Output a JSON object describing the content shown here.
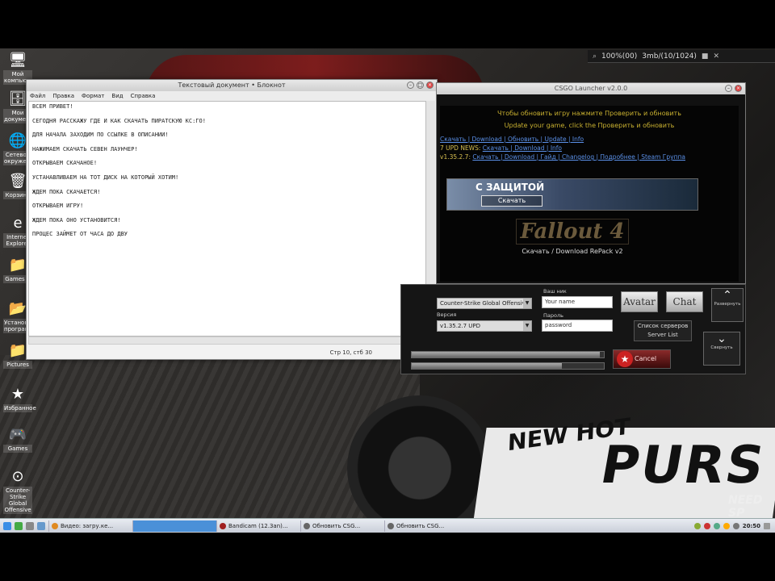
{
  "top_panel": {
    "items": [
      "100%(00)",
      "3mb/(10/1024)"
    ]
  },
  "desktop_icons": [
    {
      "label": "Мой компьютер",
      "glyph": "🖥"
    },
    {
      "label": "Мои документы",
      "glyph": "🗄"
    },
    {
      "label": "Сетевое окружение",
      "glyph": "🌐"
    },
    {
      "label": "Корзина",
      "glyph": "🗑"
    },
    {
      "label": "Internet Explorer",
      "glyph": "e"
    },
    {
      "label": "Games R",
      "glyph": "📁"
    },
    {
      "label": "Установка программ",
      "glyph": "📂"
    },
    {
      "label": "Pictures",
      "glyph": "📁"
    },
    {
      "label": "Избранное",
      "glyph": "★"
    },
    {
      "label": "Games",
      "glyph": "🎮"
    },
    {
      "label": "Counter-Strike Global Offensive",
      "glyph": "⊙"
    }
  ],
  "editor": {
    "title": "Текстовый документ • Блокнот",
    "menu": [
      "Файл",
      "Правка",
      "Формат",
      "Вид",
      "Справка"
    ],
    "lines": [
      "ВСЕМ ПРИВЕТ!",
      "СЕГОДНЯ РАССКАЖУ ГДЕ И КАК СКАЧАТЬ ПИРАТСКУЮ КС:ГО!",
      "ДЛЯ НАЧАЛА ЗАХОДИМ ПО ССЫЛКЕ В ОПИСАНИИ!",
      "НАЖИМАЕМ СКАЧАТЬ СЕВЕН ЛАУНЧЕР!",
      "ОТКРЫВАЕМ СКАЧАНОЕ!",
      "УСТАНАВЛИВАЕМ НА ТОТ ДИСК НА КОТОРЫЙ ХОТИМ!",
      "ЖДЕМ ПОКА СКАЧАЕТСЯ!",
      "ОТКРЫВАЕМ ИГРУ!",
      "ЖДЕМ ПОКА ОНО УСТАНОВИТСЯ!",
      "ПРОЦЕС ЗАЙМЕТ ОТ ЧАСА ДО ДВУ"
    ],
    "status": "Стр 10, стб 30"
  },
  "launcher": {
    "title": "CSGO Launcher v2.0.0",
    "header_line1": "Чтобы обновить игру нажмите Проверить и обновить",
    "header_line2": "Update your game, click the Проверить и обновить",
    "links": [
      {
        "prefix": "",
        "text": "Скачать | Download | Обновить | Update | Info"
      },
      {
        "prefix": "7 UPD NEWS: ",
        "text": "Скачать | Download | Info"
      },
      {
        "prefix": "v1.35.2.7: ",
        "text": "Скачать | Download | Гайд | Changelog | Подробнее | Steam Группа"
      }
    ],
    "banner_title": "С ЗАЩИТОЙ",
    "banner_button": "Скачать",
    "promo_logo": "Fallout 4",
    "promo_caption": "Скачать / Download RePack v2",
    "panel": {
      "game_label": "Игра",
      "game_value": "Counter-Strike Global Offensive",
      "version_label": "Версия",
      "version_value": "v1.35.2.7 UPD",
      "nick_label": "Ваш ник",
      "nick_value": "Your name",
      "pass_label": "Пароль",
      "pass_value": "password",
      "avatar_button": "Avatar",
      "chat_button": "Chat",
      "up_caption": "Развернуть",
      "down_caption": "Свернуть",
      "server_button_line1": "Список серверов",
      "server_button_line2": "Server List",
      "stop_button": "Cancel",
      "progress1": 0.98,
      "progress2": 0.78
    }
  },
  "taskbar": {
    "tasks": [
      {
        "label": "Видео: загру.ке...",
        "color": "#e08a20",
        "active": false
      },
      {
        "label": "",
        "color": "#4a90d8",
        "active": true
      },
      {
        "label": "Bandicam (12.3an)...",
        "color": "#a02020",
        "active": false
      },
      {
        "label": "Обновить CSG...",
        "color": "#666",
        "active": false
      },
      {
        "label": "Обновить CSG...",
        "color": "#666",
        "active": false
      }
    ],
    "clock": "20:50"
  }
}
